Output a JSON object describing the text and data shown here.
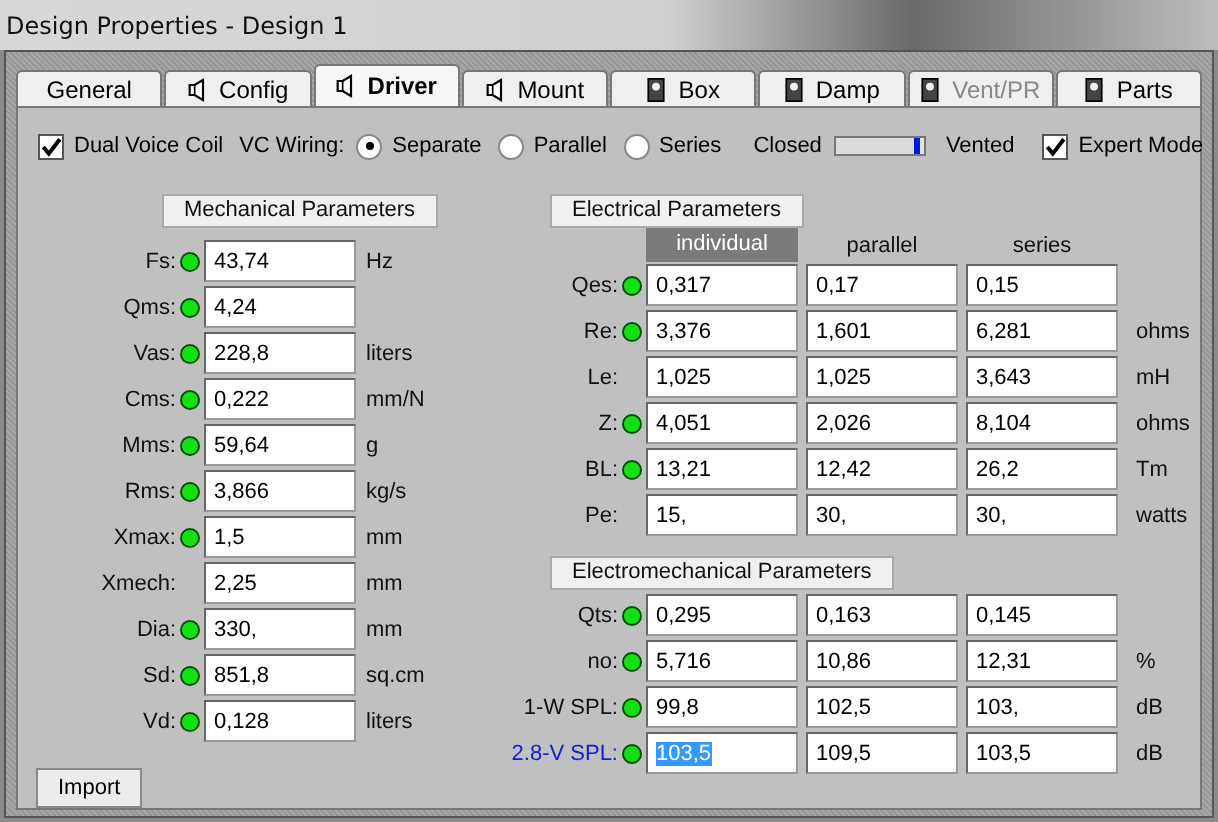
{
  "window": {
    "title": "Design Properties - Design 1"
  },
  "tabs": [
    {
      "label": "General",
      "kind": "plain",
      "selected": false,
      "disabled": false
    },
    {
      "label": "Config",
      "kind": "speaker",
      "selected": false,
      "disabled": false
    },
    {
      "label": "Driver",
      "kind": "speaker",
      "selected": true,
      "disabled": false
    },
    {
      "label": "Mount",
      "kind": "speaker",
      "selected": false,
      "disabled": false
    },
    {
      "label": "Box",
      "kind": "box",
      "selected": false,
      "disabled": false
    },
    {
      "label": "Damp",
      "kind": "box",
      "selected": false,
      "disabled": false
    },
    {
      "label": "Vent/PR",
      "kind": "box",
      "selected": false,
      "disabled": true
    },
    {
      "label": "Parts",
      "kind": "box",
      "selected": false,
      "disabled": false
    }
  ],
  "options": {
    "dual_voice_coil": {
      "label": "Dual Voice Coil",
      "checked": true
    },
    "vc_wiring": {
      "label": "VC Wiring:",
      "choices": [
        {
          "label": "Separate",
          "selected": true
        },
        {
          "label": "Parallel",
          "selected": false
        },
        {
          "label": "Series",
          "selected": false
        }
      ]
    },
    "closed_vented": {
      "left": "Closed",
      "right": "Vented",
      "level": 0.95
    },
    "expert_mode": {
      "label": "Expert Mode",
      "checked": true
    }
  },
  "mechanical": {
    "title": "Mechanical Parameters",
    "rows": [
      {
        "label": "Fs:",
        "led": true,
        "value": "43,74",
        "unit": "Hz"
      },
      {
        "label": "Qms:",
        "led": true,
        "value": "4,24"
      },
      {
        "label": "Vas:",
        "led": true,
        "value": "228,8",
        "unit": "liters"
      },
      {
        "label": "Cms:",
        "led": true,
        "value": "0,222",
        "unit": "mm/N"
      },
      {
        "label": "Mms:",
        "led": true,
        "value": "59,64",
        "unit": "g"
      },
      {
        "label": "Rms:",
        "led": true,
        "value": "3,866",
        "unit": "kg/s"
      },
      {
        "label": "Xmax:",
        "led": true,
        "value": "1,5",
        "unit": "mm"
      },
      {
        "label": "Xmech:",
        "led": false,
        "value": "2,25",
        "unit": "mm"
      },
      {
        "label": "Dia:",
        "led": true,
        "value": "330,",
        "unit": "mm"
      },
      {
        "label": "Sd:",
        "led": true,
        "value": "851,8",
        "unit": "sq.cm"
      },
      {
        "label": "Vd:",
        "led": true,
        "value": "0,128",
        "unit": "liters"
      }
    ]
  },
  "electrical": {
    "title": "Electrical Parameters",
    "columns": [
      {
        "label": "individual",
        "selected": true
      },
      {
        "label": "parallel",
        "selected": false
      },
      {
        "label": "series",
        "selected": false
      }
    ],
    "rows": [
      {
        "label": "Qes:",
        "led": true,
        "values": [
          "0,317",
          "0,17",
          "0,15"
        ]
      },
      {
        "label": "Re:",
        "led": true,
        "values": [
          "3,376",
          "1,601",
          "6,281"
        ],
        "unit": "ohms"
      },
      {
        "label": "Le:",
        "led": false,
        "values": [
          "1,025",
          "1,025",
          "3,643"
        ],
        "unit": "mH"
      },
      {
        "label": "Z:",
        "led": true,
        "values": [
          "4,051",
          "2,026",
          "8,104"
        ],
        "unit": "ohms"
      },
      {
        "label": "BL:",
        "led": true,
        "values": [
          "13,21",
          "12,42",
          "26,2"
        ],
        "unit": "Tm"
      },
      {
        "label": "Pe:",
        "led": false,
        "values": [
          "15,",
          "30,",
          "30,"
        ],
        "unit": "watts"
      }
    ]
  },
  "electromechanical": {
    "title": "Electromechanical Parameters",
    "rows": [
      {
        "label": "Qts:",
        "led": true,
        "values": [
          "0,295",
          "0,163",
          "0,145"
        ],
        "active": false
      },
      {
        "label": "no:",
        "led": true,
        "values": [
          "5,716",
          "10,86",
          "12,31"
        ],
        "unit": "%",
        "active": false
      },
      {
        "label": "1-W SPL:",
        "led": true,
        "values": [
          "99,8",
          "102,5",
          "103,"
        ],
        "unit": "dB",
        "active": false
      },
      {
        "label": "2.8-V SPL:",
        "led": true,
        "values": [
          "103,5",
          "109,5",
          "103,5"
        ],
        "unit": "dB",
        "active": true
      }
    ]
  },
  "import_button": "Import"
}
